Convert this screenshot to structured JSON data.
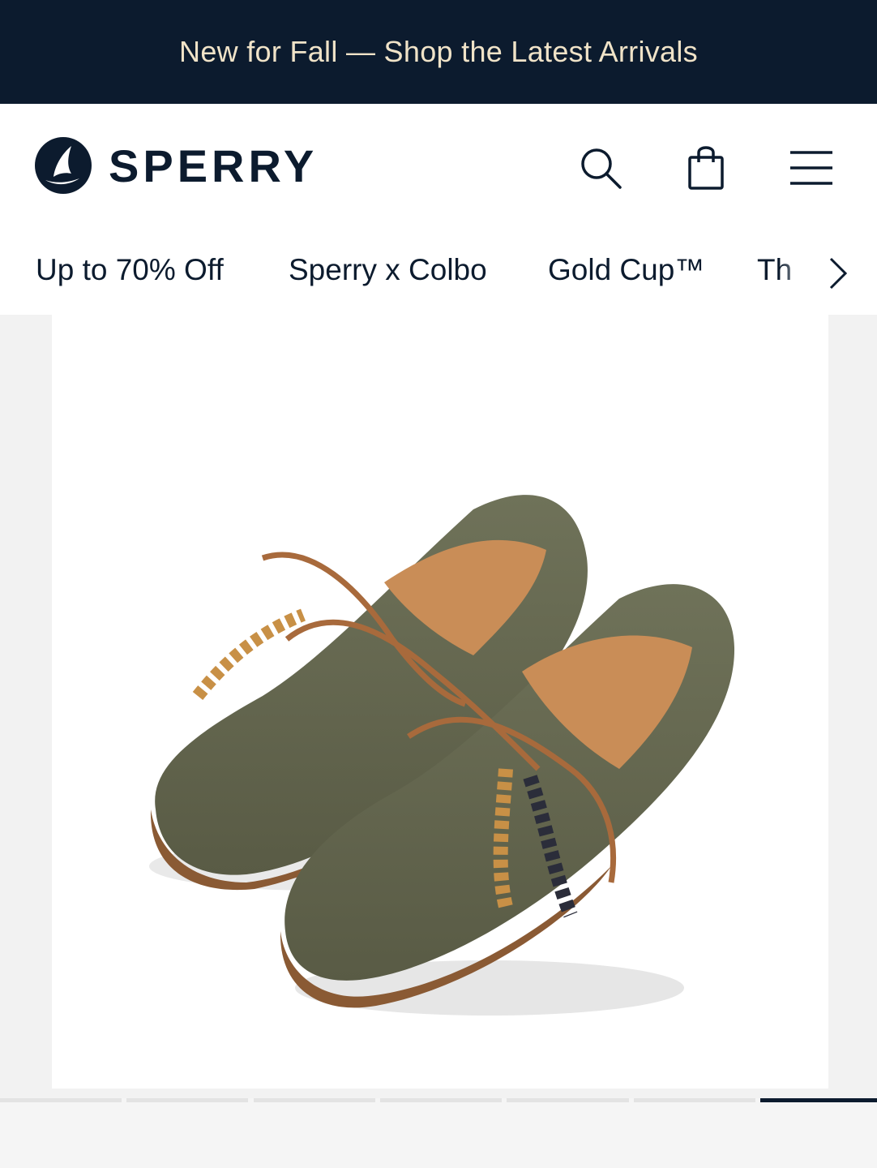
{
  "promo": {
    "text": "New for Fall — Shop the Latest Arrivals"
  },
  "header": {
    "brand": "SPERRY",
    "logo_icon": "sailboat-logo-icon",
    "icons": [
      "search-icon",
      "shopping-bag-icon",
      "hamburger-menu-icon"
    ]
  },
  "nav": {
    "items": [
      {
        "label": "Up to 70% Off"
      },
      {
        "label": "Sperry x Colbo"
      },
      {
        "label": "Gold Cup™"
      },
      {
        "label": "Th"
      }
    ],
    "next_icon": "chevron-right-icon"
  },
  "gallery": {
    "image_subject": "pair of olive green suede boat shoes with leather laces",
    "total_slides": 7,
    "active_slide": 7
  },
  "colors": {
    "promo_bg": "#0c1b2e",
    "promo_text": "#f0e3c8",
    "brand_navy": "#0c1b2e"
  }
}
